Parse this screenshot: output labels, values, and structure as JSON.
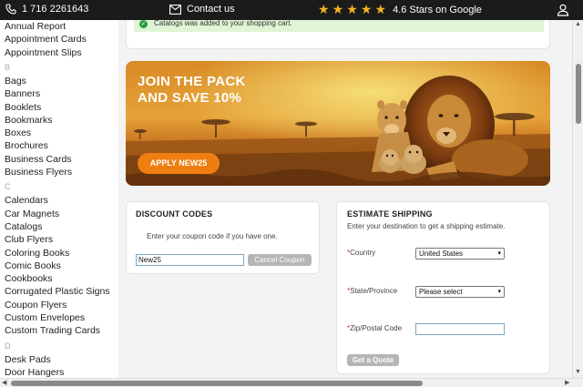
{
  "topbar": {
    "phone": "1 716 2261643",
    "contact": "Contact us",
    "rating": "4.6 Stars on Google",
    "stars": [
      "★",
      "★",
      "★",
      "★",
      "★"
    ]
  },
  "sidebar": {
    "items": [
      {
        "type": "item",
        "label": "Annual Report"
      },
      {
        "type": "item",
        "label": "Appointment Cards"
      },
      {
        "type": "item",
        "label": "Appointment Slips"
      },
      {
        "type": "letter",
        "label": "B"
      },
      {
        "type": "item",
        "label": "Bags"
      },
      {
        "type": "item",
        "label": "Banners"
      },
      {
        "type": "item",
        "label": "Booklets"
      },
      {
        "type": "item",
        "label": "Bookmarks"
      },
      {
        "type": "item",
        "label": "Boxes"
      },
      {
        "type": "item",
        "label": "Brochures"
      },
      {
        "type": "item",
        "label": "Business Cards"
      },
      {
        "type": "item",
        "label": "Business Flyers"
      },
      {
        "type": "letter",
        "label": "C"
      },
      {
        "type": "item",
        "label": "Calendars"
      },
      {
        "type": "item",
        "label": "Car Magnets"
      },
      {
        "type": "item",
        "label": "Catalogs"
      },
      {
        "type": "item",
        "label": "Club Flyers"
      },
      {
        "type": "item",
        "label": "Coloring Books"
      },
      {
        "type": "item",
        "label": "Comic Books"
      },
      {
        "type": "item",
        "label": "Cookbooks"
      },
      {
        "type": "item",
        "label": "Corrugated Plastic Signs"
      },
      {
        "type": "item",
        "label": "Coupon Flyers"
      },
      {
        "type": "item",
        "label": "Custom Envelopes"
      },
      {
        "type": "item",
        "label": "Custom Trading Cards"
      },
      {
        "type": "letter",
        "label": "D"
      },
      {
        "type": "item",
        "label": "Desk Pads"
      },
      {
        "type": "item",
        "label": "Door Hangers"
      }
    ]
  },
  "alert": {
    "text": "Catalogs was added to your shopping cart."
  },
  "banner": {
    "title_line1": "JOIN THE PACK",
    "title_line2": "AND SAVE 10%",
    "button": "APPLY NEW25"
  },
  "discount": {
    "title": "DISCOUNT CODES",
    "hint": "Enter your coupon code if you have one.",
    "coupon_value": "New25",
    "cancel_button": "Cancel Coupon"
  },
  "shipping": {
    "title": "ESTIMATE SHIPPING",
    "subtitle": "Enter your destination to get a shipping estimate.",
    "required_mark": "*",
    "country_label": "Country",
    "country_value": "United States",
    "state_label": "State/Province",
    "state_value": "Please select",
    "zip_label": "Zip/Postal Code",
    "zip_value": "",
    "quote_button": "Get a Quote"
  },
  "colors": {
    "topbar": "#1b1b1b",
    "star": "#f2b51e",
    "banner_button": "#ef7e12",
    "alert_bg": "#dff5d6",
    "required": "#c0392b"
  }
}
